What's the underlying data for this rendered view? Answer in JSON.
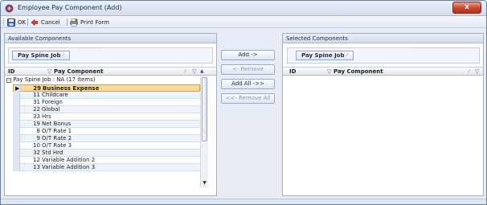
{
  "window": {
    "title": "Employee Pay Component (Add)",
    "close_label": "x",
    "accent": "#c8442b"
  },
  "toolbar": {
    "ok_label": "OK",
    "cancel_label": "Cancel",
    "print_label": "Print Form"
  },
  "available": {
    "title": "Available Components",
    "group_chip": "Pay Spine Job",
    "columns": {
      "id": "ID",
      "pay_component": "Pay Component"
    },
    "group_row": "Pay Spine Job : NA (17 items)",
    "rows": [
      {
        "id": "29",
        "name": "Business Expense",
        "selected": true
      },
      {
        "id": "11",
        "name": "Childcare"
      },
      {
        "id": "31",
        "name": "Foreign"
      },
      {
        "id": "22",
        "name": "Global"
      },
      {
        "id": "33",
        "name": "Hrs"
      },
      {
        "id": "19",
        "name": "Net Bonus"
      },
      {
        "id": "8",
        "name": "O/T Rate 1"
      },
      {
        "id": "9",
        "name": "O/T Rate 2"
      },
      {
        "id": "10",
        "name": "O/T Rate 3"
      },
      {
        "id": "32",
        "name": "Std Hrd"
      },
      {
        "id": "12",
        "name": "Variable Addition 2"
      },
      {
        "id": "13",
        "name": "Variable Addition 3"
      }
    ]
  },
  "actions": {
    "add": "Add ->",
    "remove": "<- Remove",
    "add_all": "Add All ->>",
    "remove_all": "<<- Remove All"
  },
  "selected": {
    "title": "Selected Components",
    "group_chip": "Pay Spine Job",
    "columns": {
      "id": "ID",
      "pay_component": "Pay Component"
    }
  }
}
